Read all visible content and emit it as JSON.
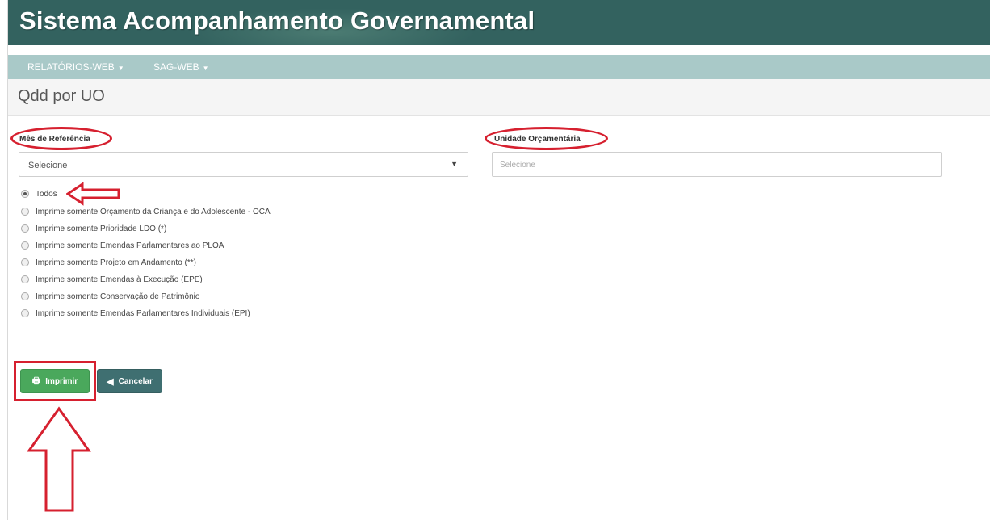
{
  "app": {
    "title": "Sistema Acompanhamento Governamental"
  },
  "nav": {
    "items": [
      {
        "label": "RELATÓRIOS-WEB"
      },
      {
        "label": "SAG-WEB"
      }
    ]
  },
  "page": {
    "title": "Qdd por UO"
  },
  "form": {
    "month": {
      "label": "Mês de Referência",
      "value": "Selecione",
      "icon": "dropdown-arrow-icon"
    },
    "unit": {
      "label": "Unidade Orçamentária",
      "placeholder": "Selecione"
    },
    "options": [
      {
        "label": "Todos",
        "checked": true
      },
      {
        "label": "Imprime somente Orçamento da Criança e do Adolescente - OCA",
        "checked": false
      },
      {
        "label": "Imprime somente Prioridade LDO (*)",
        "checked": false
      },
      {
        "label": "Imprime somente Emendas Parlamentares ao PLOA",
        "checked": false
      },
      {
        "label": "Imprime somente Projeto em Andamento (**)",
        "checked": false
      },
      {
        "label": "Imprime somente Emendas à Execução (EPE)",
        "checked": false
      },
      {
        "label": "Imprime somente Conservação de Patrimônio",
        "checked": false
      },
      {
        "label": "Imprime somente Emendas Parlamentares Individuais (EPI)",
        "checked": false
      }
    ]
  },
  "actions": {
    "print": {
      "label": "Imprimir",
      "icon": "printer-icon"
    },
    "cancel": {
      "label": "Cancelar",
      "icon": "back-arrow-icon"
    }
  },
  "colors": {
    "header": "#33625f",
    "navbar": "#a9c9c8",
    "annotation": "#d6202f",
    "print_button": "#4aa85c",
    "cancel_button": "#3f6f71"
  }
}
